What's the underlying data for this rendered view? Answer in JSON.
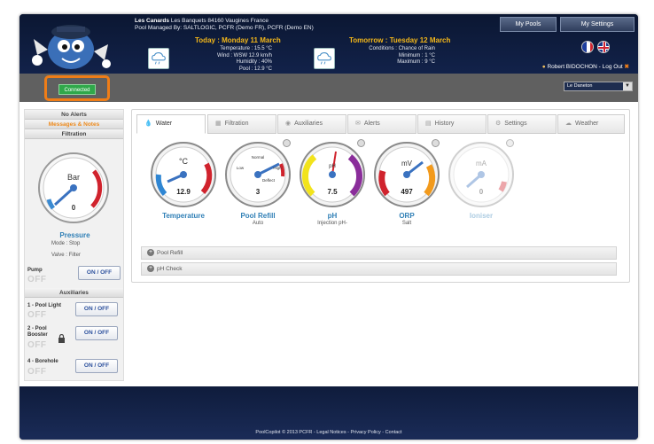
{
  "header": {
    "site_name": "Les Canards",
    "address": "Les Banquets 84160 Vaugines France",
    "managed_by": "Pool Managed By: SALTLOGIC, PCFR (Demo FR), PCFR (Demo EN)",
    "today": {
      "heading": "Today : Monday 11 March",
      "temperature": "Temperature : 15.5 °C",
      "wind": "Wind : WSW 12.9 km/h",
      "humidity": "Humidity : 40%",
      "pool": "Pool : 12.9 °C"
    },
    "tomorrow": {
      "heading": "Tomorrow : Tuesday 12 March",
      "conditions": "Conditions : Chance of Rain",
      "minimum": "Minimum : 1 °C",
      "maximum": "Maximum : 9 °C"
    },
    "my_pools_label": "My Pools",
    "my_settings_label": "My Settings",
    "user_text": "Robert BIDOCHON - Log Out"
  },
  "status": {
    "connection": "Connected",
    "pool_select_value": "Le Daneton"
  },
  "sidebar": {
    "alerts_header": "No Alerts",
    "messages_header": "Messages & Notes",
    "filtration_header": "Filtration",
    "pressure": {
      "unit": "Bar",
      "value": "0",
      "label": "Pressure",
      "mode": "Mode : Stop",
      "valve": "Valve : Filter"
    },
    "pump_label": "Pump",
    "pump_state": "OFF",
    "onoff_label": "ON / OFF",
    "auxiliaries_header": "Auxiliaries",
    "aux": [
      {
        "label": "1 - Pool Light",
        "state": "OFF"
      },
      {
        "label": "2 - Pool Booster",
        "state": "OFF"
      },
      {
        "label": "4 - Borehole",
        "state": "OFF"
      }
    ]
  },
  "tabs": [
    {
      "label": "Water",
      "icon": "drop-icon"
    },
    {
      "label": "Filtration",
      "icon": "filter-icon"
    },
    {
      "label": "Auxiliaries",
      "icon": "bulb-icon"
    },
    {
      "label": "Alerts",
      "icon": "envelope-icon"
    },
    {
      "label": "History",
      "icon": "chart-icon"
    },
    {
      "label": "Settings",
      "icon": "gear-icon"
    },
    {
      "label": "Weather",
      "icon": "cloud-icon"
    }
  ],
  "gauges": [
    {
      "unit": "°C",
      "value": "12.9",
      "label": "Temperature",
      "sub": ""
    },
    {
      "unit": "Normal",
      "unit2": "Deflect",
      "value": "3",
      "label": "Pool Refill",
      "sub": "Auto",
      "left_tick": "Low",
      "right_tick": "High"
    },
    {
      "unit": "pH",
      "value": "7.5",
      "label": "pH",
      "sub": "Injection pH-"
    },
    {
      "unit": "mV",
      "value": "497",
      "label": "ORP",
      "sub": "Salt"
    },
    {
      "unit": "mA",
      "value": "0",
      "label": "Ioniser",
      "sub": ""
    }
  ],
  "accordion": {
    "pool_refill": "Pool Refill",
    "ph_check": "pH Check"
  },
  "footer": {
    "text": "PoolCopilot © 2013 PCFR - Legal Notices - Privacy Policy - Contact"
  }
}
